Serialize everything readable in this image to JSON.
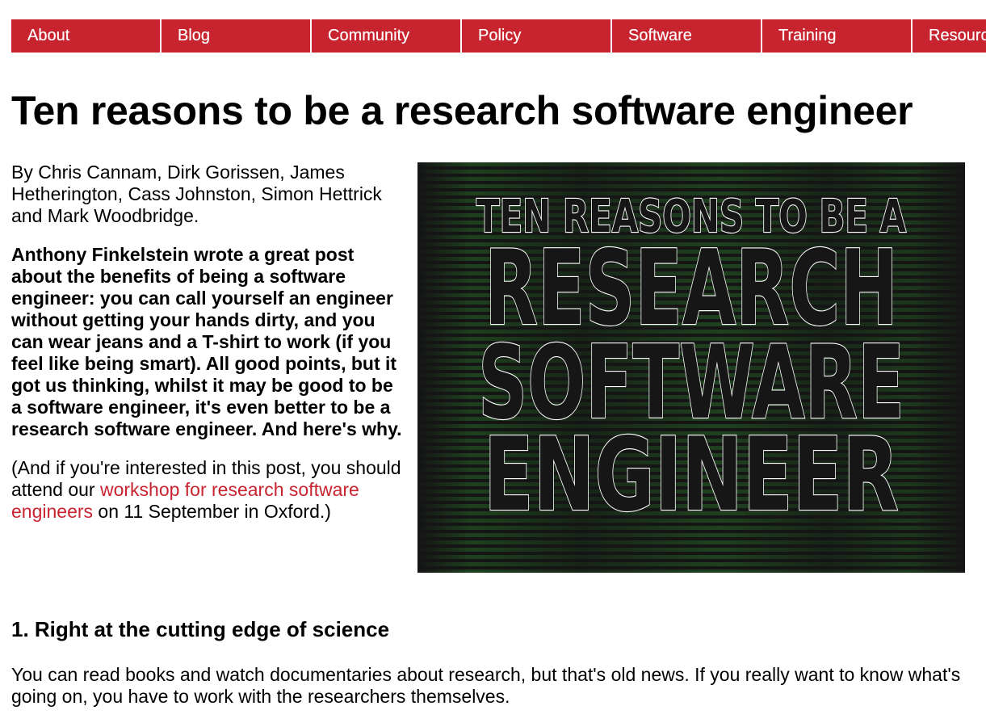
{
  "nav": {
    "items": [
      {
        "label": "About"
      },
      {
        "label": "Blog"
      },
      {
        "label": "Community"
      },
      {
        "label": "Policy"
      },
      {
        "label": "Software"
      },
      {
        "label": "Training"
      },
      {
        "label": "Resources"
      }
    ]
  },
  "article": {
    "title": "Ten reasons to be a research software engineer",
    "authors": "By Chris Cannam, Dirk Gorissen, James Hetherington, Cass Johnston, Simon Hettrick and Mark Woodbridge.",
    "intro": "Anthony Finkelstein wrote a great post about the benefits of being a software engineer: you can call yourself an engineer without getting your hands dirty, and you can wear jeans and a T-shirt to work (if you feel like being smart). All good points, but it got us thinking, whilst it may be good to be a software engineer, it's even better to be a research software engineer. And here's why.",
    "note_before": "(And if you're interested in this post, you should attend our ",
    "note_link": "workshop for research software engineers",
    "note_after": " on 11 September in Oxford.)",
    "hero_image": {
      "line1": "TEN REASONS TO BE A",
      "line2": "RESEARCH",
      "line3": "SOFTWARE",
      "line4": "ENGINEER"
    },
    "section1": {
      "heading": "1. Right at the cutting edge of science",
      "text": "You can read books and watch documentaries about research, but that's old news. If you really want to know what's going on, you have to work with the researchers themselves."
    }
  },
  "colors": {
    "accent": "#c8242f",
    "hero_background": "#151515",
    "hero_code": "#3a8a3a"
  }
}
